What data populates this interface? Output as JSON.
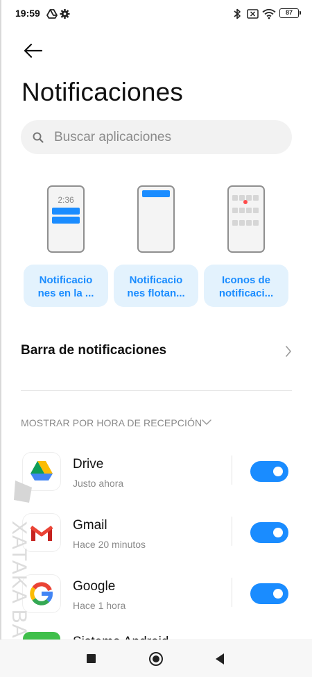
{
  "status_bar": {
    "time": "19:59",
    "battery": "87",
    "icons": [
      "drive-sync-icon",
      "settings-gear-icon",
      "bluetooth-icon",
      "no-sim-icon",
      "wifi-icon",
      "battery-icon"
    ]
  },
  "header": {
    "back_icon": "arrow-left-icon",
    "title": "Notificaciones"
  },
  "search": {
    "placeholder": "Buscar aplicaciones",
    "value": ""
  },
  "styles": {
    "preview_time": "2:36",
    "items": [
      {
        "label": "Notificacio nes en la ..."
      },
      {
        "label": "Notificacio nes flotan..."
      },
      {
        "label": "Iconos de notificaci..."
      }
    ]
  },
  "settings": {
    "notification_bar_label": "Barra de notificaciones"
  },
  "section": {
    "sort_label": "MOSTRAR POR HORA DE RECEPCIÓN"
  },
  "apps": [
    {
      "name": "Drive",
      "time": "Justo ahora",
      "icon": "google-drive-icon",
      "enabled": true
    },
    {
      "name": "Gmail",
      "time": "Hace 20 minutos",
      "icon": "gmail-icon",
      "enabled": true
    },
    {
      "name": "Google",
      "time": "Hace 1 hora",
      "icon": "google-icon",
      "enabled": true
    },
    {
      "name": "Sistema Android",
      "time": "",
      "icon": "android-system-icon",
      "enabled": true
    }
  ],
  "watermark": {
    "text": "XATAKA BASICS"
  },
  "nav": {
    "items": [
      "recents-icon",
      "home-icon",
      "back-icon"
    ]
  },
  "colors": {
    "accent": "#1a8cff",
    "chip_bg": "#e3f2fd",
    "secondary_text": "#8a8a8a"
  }
}
